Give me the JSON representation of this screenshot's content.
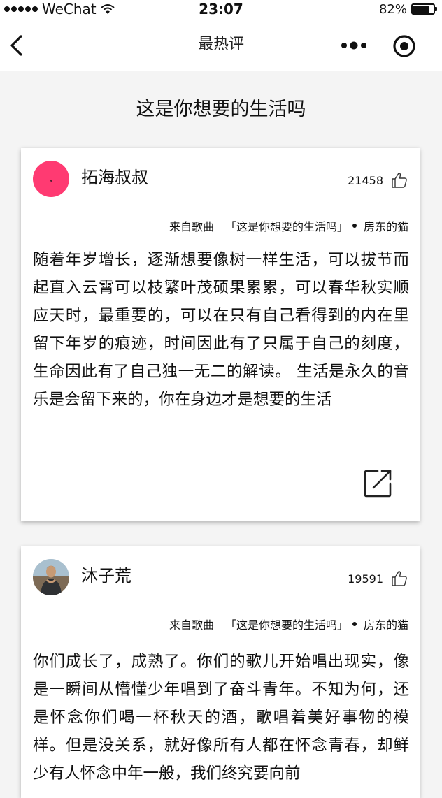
{
  "status_bar": {
    "carrier": "WeChat",
    "time": "23:07",
    "battery": "82%",
    "battery_level": 0.82,
    "signal_icon": "signal-dots-icon",
    "wifi_icon": "wifi-icon",
    "battery_icon": "battery-icon"
  },
  "nav": {
    "title": "最热评",
    "back_icon": "chevron-left-icon",
    "more_icon": "more-dots-icon",
    "close_icon": "target-circle-icon"
  },
  "song_title": "这是你想要的生活吗",
  "comments": [
    {
      "username": "拓海叔叔",
      "avatar": "pink-avatar",
      "likes": "21458",
      "source_prefix": "来自歌曲",
      "song": "「这是你想要的生活吗」",
      "artist": "房东的猫",
      "text": "随着年岁增长，逐渐想要像树一样生活，可以拔节而起直入云霄可以枝繁叶茂硕果累累，可以春华秋实顺应天时，最重要的，可以在只有自己看得到的内在里留下年岁的痕迹，时间因此有了只属于自己的刻度，生命因此有了自己独一无二的解读。 生活是永久的音乐是会留下来的，你在身边才是想要的生活"
    },
    {
      "username": "沐子荒",
      "avatar": "photo-avatar",
      "likes": "19591",
      "source_prefix": "来自歌曲",
      "song": "「这是你想要的生活吗」",
      "artist": "房东的猫",
      "text": "你们成长了，成熟了。你们的歌儿开始唱出现实，像是一瞬间从懵懂少年唱到了奋斗青年。不知为何，还是怀念你们喝一杯秋天的酒，歌唱着美好事物的模样。但是没关系，就好像所有人都在怀念青春，却鲜少有人怀念中年一般，我们终究要向前"
    }
  ],
  "colors": {
    "background": "#f4f4f4",
    "card": "#ffffff",
    "avatar_pink": "#ff3a72",
    "text": "#111111"
  }
}
